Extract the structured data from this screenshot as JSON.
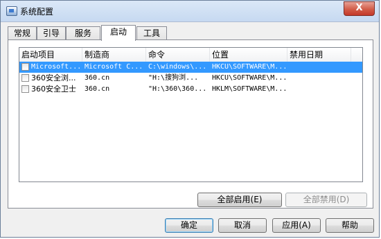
{
  "window": {
    "title": "系统配置",
    "close_label": "X"
  },
  "tabs": [
    "常规",
    "引导",
    "服务",
    "启动",
    "工具"
  ],
  "active_tab": 3,
  "list": {
    "columns": [
      "启动项目",
      "制造商",
      "命令",
      "位置",
      "禁用日期"
    ],
    "rows": [
      {
        "checked": false,
        "selected": true,
        "cells": [
          "Microsoft...",
          "Microsoft C...",
          "C:\\windows\\...",
          "HKCU\\SOFTWARE\\M...",
          ""
        ]
      },
      {
        "checked": false,
        "selected": false,
        "cells": [
          "360安全浏...",
          "360.cn",
          "\"H:\\搜狗浏...",
          "HKCU\\SOFTWARE\\M...",
          ""
        ]
      },
      {
        "checked": false,
        "selected": false,
        "cells": [
          "360安全卫士",
          "360.cn",
          "\"H:\\360\\360...",
          "HKLM\\SOFTWARE\\M...",
          ""
        ]
      }
    ]
  },
  "panel_buttons": {
    "enable_all": "全部启用(E)",
    "disable_all": "全部禁用(D)"
  },
  "dialog_buttons": {
    "ok": "确定",
    "cancel": "取消",
    "apply": "应用(A)",
    "help": "帮助"
  }
}
